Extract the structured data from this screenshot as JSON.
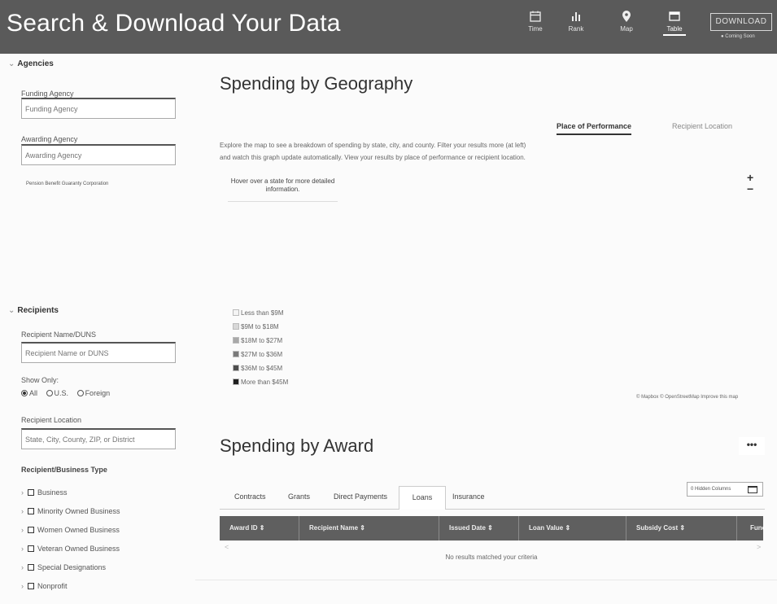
{
  "header": {
    "title": "Search & Download Your Data",
    "views": [
      {
        "label": "Time",
        "icon": "calendar-icon"
      },
      {
        "label": "Rank",
        "icon": "bar-chart-icon"
      },
      {
        "label": "Map",
        "icon": "map-pin-icon"
      },
      {
        "label": "Table",
        "icon": "table-icon",
        "active": true
      }
    ],
    "download_label": "DOWNLOAD",
    "coming_soon": "Coming Soon"
  },
  "sidebar": {
    "agencies": {
      "heading": "Agencies",
      "funding_label": "Funding Agency",
      "funding_placeholder": "Funding Agency",
      "awarding_label": "Awarding Agency",
      "awarding_placeholder": "Awarding Agency",
      "selected_agency": "Pension Benefit Guaranty Corporation"
    },
    "recipients": {
      "heading": "Recipients",
      "name_label": "Recipient Name/DUNS",
      "name_placeholder": "Recipient Name or DUNS",
      "show_only_label": "Show Only:",
      "show_only_options": [
        "All",
        "U.S.",
        "Foreign"
      ],
      "show_only_selected": "All",
      "location_label": "Recipient Location",
      "location_placeholder": "State, City, County, ZIP, or District",
      "business_type_label": "Recipient/Business Type",
      "business_types": [
        "Business",
        "Minority Owned Business",
        "Women Owned Business",
        "Veteran Owned Business",
        "Special Designations",
        "Nonprofit"
      ]
    }
  },
  "geography": {
    "title": "Spending by Geography",
    "description": "Explore the map to see a breakdown of spending by state, city, and county. Filter your results more (at left) and watch this graph update automatically. View your results by place of performance or recipient location.",
    "tabs": [
      "Place of Performance",
      "Recipient Location"
    ],
    "active_tab": "Place of Performance",
    "hover_hint": "Hover over a state for more detailed information.",
    "zoom_in": "+",
    "zoom_out": "−",
    "legend": [
      {
        "label": "Less than $9M",
        "color": "#f4f4f4"
      },
      {
        "label": "$9M to $18M",
        "color": "#d8d8d8"
      },
      {
        "label": "$18M to $27M",
        "color": "#a9a9a9"
      },
      {
        "label": "$27M to $36M",
        "color": "#7a7a7a"
      },
      {
        "label": "$36M to $45M",
        "color": "#4d4d4d"
      },
      {
        "label": "More than $45M",
        "color": "#1f1f1f"
      }
    ],
    "attribution": "© Mapbox © OpenStreetMap Improve this map"
  },
  "award": {
    "title": "Spending by Award",
    "more_label": "•••",
    "tabs": [
      "Contracts",
      "Grants",
      "Direct Payments",
      "Loans",
      "Insurance"
    ],
    "active_tab": "Loans",
    "hidden_columns_label": "0 Hidden Columns",
    "columns": [
      "Award ID",
      "Recipient Name",
      "Issued Date",
      "Loan Value",
      "Subsidy Cost",
      "Func"
    ],
    "sort_glyph": "⇕",
    "empty_message": "No results matched your criteria",
    "scroll_left": "<",
    "scroll_right": ">"
  },
  "colors": {
    "header_bg": "#5a5a5a",
    "table_header_bg": "#5f5f5f",
    "page_bg": "#fbfbfb"
  }
}
